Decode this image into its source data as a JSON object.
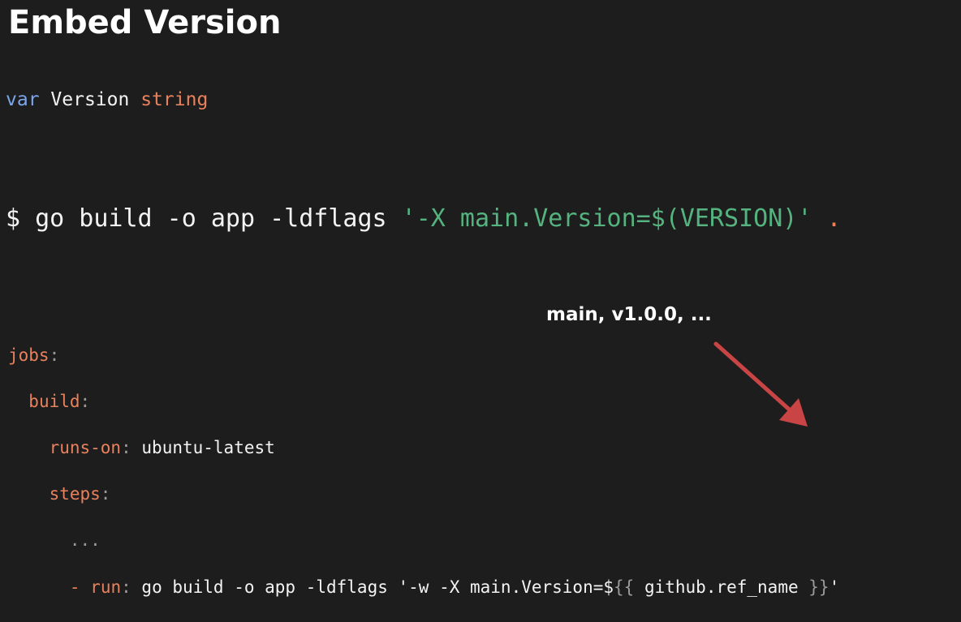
{
  "slide": {
    "title": "Embed Version"
  },
  "go_declaration": {
    "keyword": "var",
    "name": "Version",
    "type": "string"
  },
  "build_command": {
    "prompt": "$",
    "command": "go build -o app -ldflags",
    "flag_value": "'-X main.Version=$(VERSION)'",
    "target": "."
  },
  "workflow": {
    "jobs_key": "jobs",
    "build_key": "build",
    "runs_on_key": "runs-on",
    "runs_on_value": "ubuntu-latest",
    "steps_key": "steps",
    "ellipsis": "...",
    "step_dash": "-",
    "run_key": "run",
    "run_command": "go build -o app -ldflags '-w -X main.Version=$",
    "expr_open": "{{",
    "expr_body": "github.ref_name",
    "expr_close": "}}",
    "closing_quote": "'"
  },
  "annotation": {
    "text": "main, v1.0.0, ...",
    "arrow_color": "#c94545"
  },
  "colors": {
    "background": "#1d1d1d",
    "text": "#f3f3f3",
    "keyword": "#7ca6ec",
    "type_and_keys": "#e9815c",
    "string": "#54b37e",
    "punctuation": "#9a9a9a"
  }
}
